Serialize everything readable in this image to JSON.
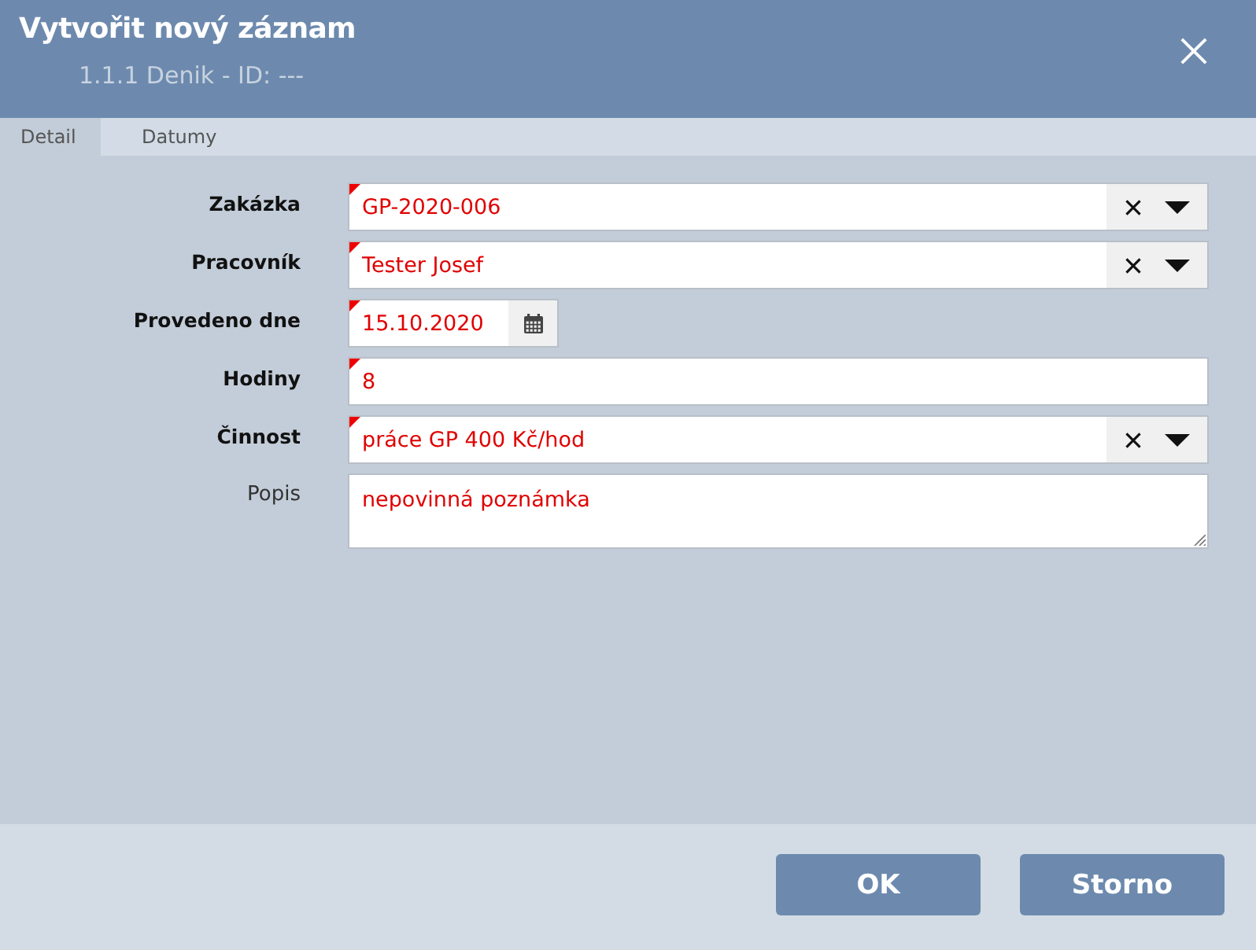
{
  "window": {
    "title": "Vytvořit nový záznam",
    "subtitle": "1.1.1 Denik - ID: ---"
  },
  "tabs": [
    {
      "label": "Detail",
      "selected": true
    },
    {
      "label": "Datumy",
      "selected": false
    }
  ],
  "fields": [
    {
      "label": "Zakázka",
      "kind": "combo",
      "value": "GP-2020-006",
      "required": true
    },
    {
      "label": "Pracovník",
      "kind": "combo",
      "value": "Tester Josef",
      "required": true
    },
    {
      "label": "Provedeno dne",
      "kind": "date",
      "value": "15.10.2020",
      "required": true
    },
    {
      "label": "Hodiny",
      "kind": "text",
      "value": "8",
      "required": true
    },
    {
      "label": "Činnost",
      "kind": "combo",
      "value": "práce GP 400 Kč/hod",
      "required": true
    },
    {
      "label": "Popis",
      "kind": "textarea",
      "value": "nepovinná poznámka",
      "required": false
    }
  ],
  "buttons": [
    {
      "label": "OK"
    },
    {
      "label": "Storno"
    }
  ]
}
